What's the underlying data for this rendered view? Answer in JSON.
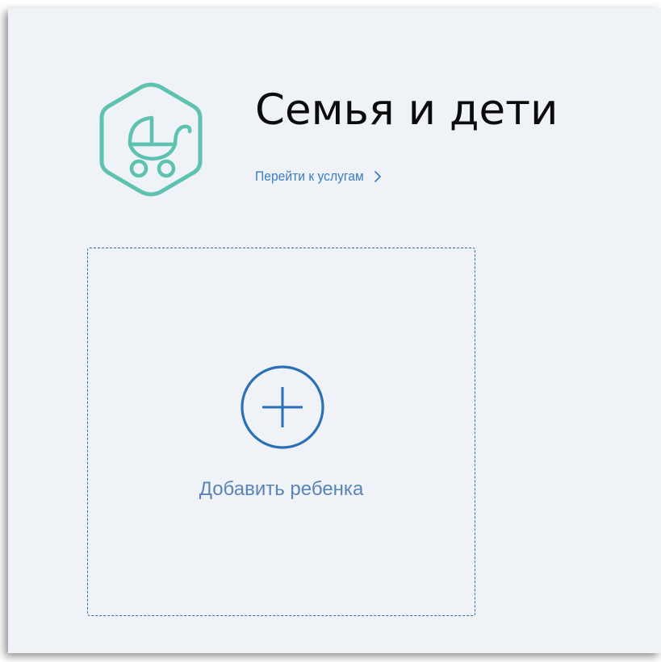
{
  "category": {
    "icon": "baby-stroller-icon",
    "title": "Семья и дети",
    "services_link": "Перейти к услугам",
    "services_link_chevron": "chevron-right-icon"
  },
  "add_child": {
    "icon": "plus-circle-icon",
    "label": "Добавить ребенка"
  },
  "colors": {
    "background": "#eff2f6",
    "icon_teal": "#5ec2b0",
    "link_blue": "#3a7fc1",
    "accent_blue": "#2a70b8",
    "label_blue": "#5a84b8",
    "title_text": "#0b0b0b"
  }
}
